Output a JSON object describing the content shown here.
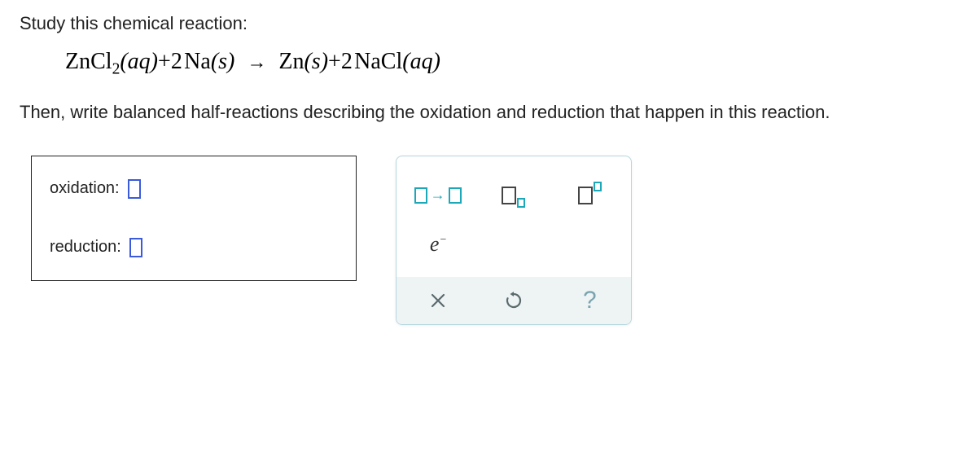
{
  "instruction1": "Study this chemical reaction:",
  "equation": {
    "lhs_part1": "ZnCl",
    "lhs_sub": "2",
    "lhs_state1": "(aq)",
    "plus1": "+",
    "lhs_coef2": "2",
    "lhs_part2": "Na",
    "lhs_state2": "(s)",
    "arrow": "→",
    "rhs_part1": "Zn",
    "rhs_state1": "(s)",
    "plus2": "+",
    "rhs_coef2": "2",
    "rhs_part2": "NaCl",
    "rhs_state2": "(aq)"
  },
  "instruction2": "Then, write balanced half-reactions describing the oxidation and reduction that happen in this reaction.",
  "answers": {
    "oxidation_label": "oxidation:",
    "reduction_label": "reduction:"
  },
  "tools": {
    "reaction_arrow": "arrow-tool",
    "subscript": "subscript-tool",
    "superscript": "superscript-tool",
    "electron": "e",
    "electron_charge": "−",
    "clear": "×",
    "reset": "↺",
    "help": "?"
  }
}
